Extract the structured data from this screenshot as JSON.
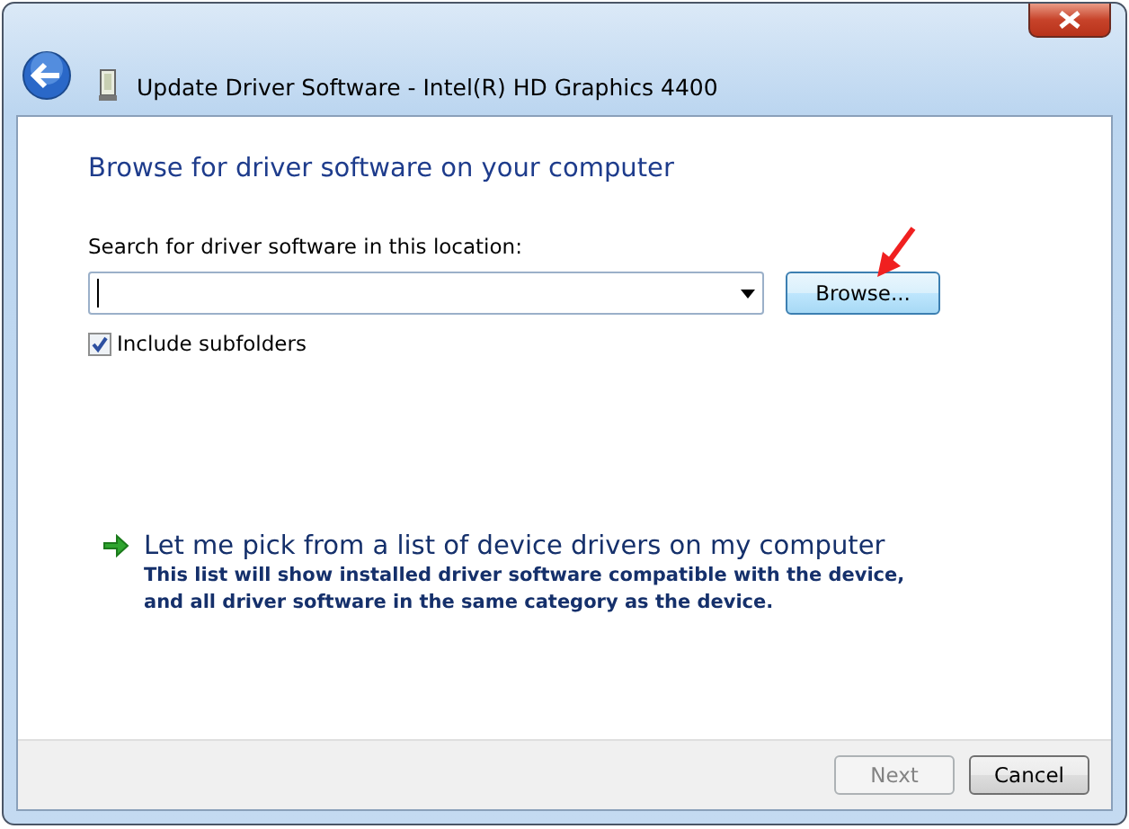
{
  "window": {
    "title": "Update Driver Software - Intel(R) HD Graphics 4400"
  },
  "heading": "Browse for driver software on your computer",
  "location": {
    "label": "Search for driver software in this location:",
    "browse_button": "Browse..."
  },
  "include_subfolders": {
    "label": "Include subfolders",
    "checked": true
  },
  "option": {
    "title": "Let me pick from a list of device drivers on my computer",
    "description": "This list will show installed driver software compatible with the device, and all driver software in the same category as the device."
  },
  "buttons": [
    {
      "label": "Next",
      "disabled": true
    },
    {
      "label": "Cancel",
      "disabled": false
    }
  ]
}
